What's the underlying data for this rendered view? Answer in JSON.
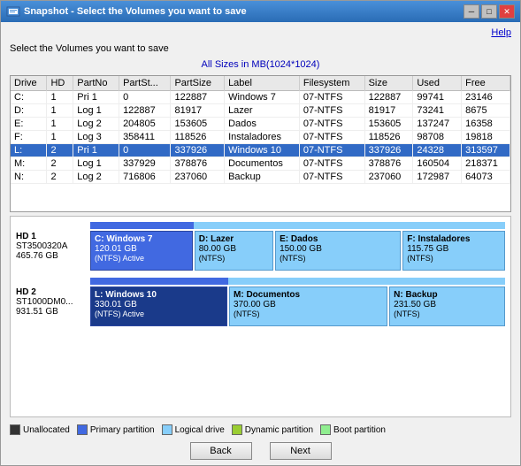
{
  "window": {
    "title": "Snapshot - Select the Volumes you want to save",
    "help_label": "Help"
  },
  "header": {
    "subtitle": "Select the Volumes you want to save",
    "sizes_note": "All Sizes in MB(1024*1024)"
  },
  "table": {
    "columns": [
      "Drive",
      "HD",
      "PartNo",
      "PartSt...",
      "PartSize",
      "Label",
      "Filesystem",
      "Size",
      "Used",
      "Free"
    ],
    "rows": [
      {
        "drive": "C:",
        "hd": "1",
        "partno": "Pri 1",
        "partst": "0",
        "partsize": "122887",
        "label": "Windows 7",
        "filesystem": "07-NTFS",
        "size": "122887",
        "used": "99741",
        "free": "23146",
        "selected": false
      },
      {
        "drive": "D:",
        "hd": "1",
        "partno": "Log 1",
        "partst": "122887",
        "partsize": "81917",
        "label": "Lazer",
        "filesystem": "07-NTFS",
        "size": "81917",
        "used": "73241",
        "free": "8675",
        "selected": false
      },
      {
        "drive": "E:",
        "hd": "1",
        "partno": "Log 2",
        "partst": "204805",
        "partsize": "153605",
        "label": "Dados",
        "filesystem": "07-NTFS",
        "size": "153605",
        "used": "137247",
        "free": "16358",
        "selected": false
      },
      {
        "drive": "F:",
        "hd": "1",
        "partno": "Log 3",
        "partst": "358411",
        "partsize": "118526",
        "label": "Instaladores",
        "filesystem": "07-NTFS",
        "size": "118526",
        "used": "98708",
        "free": "19818",
        "selected": false
      },
      {
        "drive": "L:",
        "hd": "2",
        "partno": "Pri 1",
        "partst": "0",
        "partsize": "337926",
        "label": "Windows 10",
        "filesystem": "07-NTFS",
        "size": "337926",
        "used": "24328",
        "free": "313597",
        "selected": true
      },
      {
        "drive": "M:",
        "hd": "2",
        "partno": "Log 1",
        "partst": "337929",
        "partsize": "378876",
        "label": "Documentos",
        "filesystem": "07-NTFS",
        "size": "378876",
        "used": "160504",
        "free": "218371",
        "selected": false
      },
      {
        "drive": "N:",
        "hd": "2",
        "partno": "Log 2",
        "partst": "716806",
        "partsize": "237060",
        "label": "Backup",
        "filesystem": "07-NTFS",
        "size": "237060",
        "used": "172987",
        "free": "64073",
        "selected": false
      }
    ]
  },
  "disks": [
    {
      "name": "HD 1",
      "model": "ST3500320A",
      "size": "465.76 GB",
      "partitions": [
        {
          "label": "C: Windows 7",
          "size": "120.01 GB",
          "fs": "(NTFS) Active",
          "type": "primary",
          "flex": 2
        },
        {
          "label": "D: Lazer",
          "size": "80.00 GB",
          "fs": "(NTFS)",
          "type": "logical",
          "flex": 1.5
        },
        {
          "label": "E: Dados",
          "size": "150.00 GB",
          "fs": "(NTFS)",
          "type": "logical",
          "flex": 2.5
        },
        {
          "label": "F: Instaladores",
          "size": "115.75 GB",
          "fs": "(NTFS)",
          "type": "logical",
          "flex": 2
        }
      ]
    },
    {
      "name": "HD 2",
      "model": "ST1000DM0...",
      "size": "931.51 GB",
      "partitions": [
        {
          "label": "L: Windows 10",
          "size": "330.01 GB",
          "fs": "(NTFS) Active",
          "type": "primary-selected",
          "flex": 3
        },
        {
          "label": "M: Documentos",
          "size": "370.00 GB",
          "fs": "(NTFS)",
          "type": "logical",
          "flex": 3.5
        },
        {
          "label": "N: Backup",
          "size": "231.50 GB",
          "fs": "(NTFS)",
          "type": "logical",
          "flex": 2.5
        }
      ]
    }
  ],
  "legend": [
    {
      "label": "Unallocated",
      "color": "#333333"
    },
    {
      "label": "Primary partition",
      "color": "#4169e1"
    },
    {
      "label": "Logical drive",
      "color": "#87cefa"
    },
    {
      "label": "Dynamic partition",
      "color": "#9acd32"
    },
    {
      "label": "Boot partition",
      "color": "#90ee90"
    }
  ],
  "buttons": {
    "back_label": "Back",
    "next_label": "Next"
  }
}
